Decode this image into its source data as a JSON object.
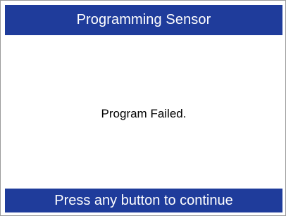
{
  "header": {
    "title": "Programming Sensor"
  },
  "message": {
    "text": "Program Failed."
  },
  "footer": {
    "prompt": "Press any button to continue"
  },
  "colors": {
    "bar_background": "#1f3c9b",
    "bar_text": "#ffffff",
    "content_background": "#ffffff",
    "content_text": "#000000"
  }
}
